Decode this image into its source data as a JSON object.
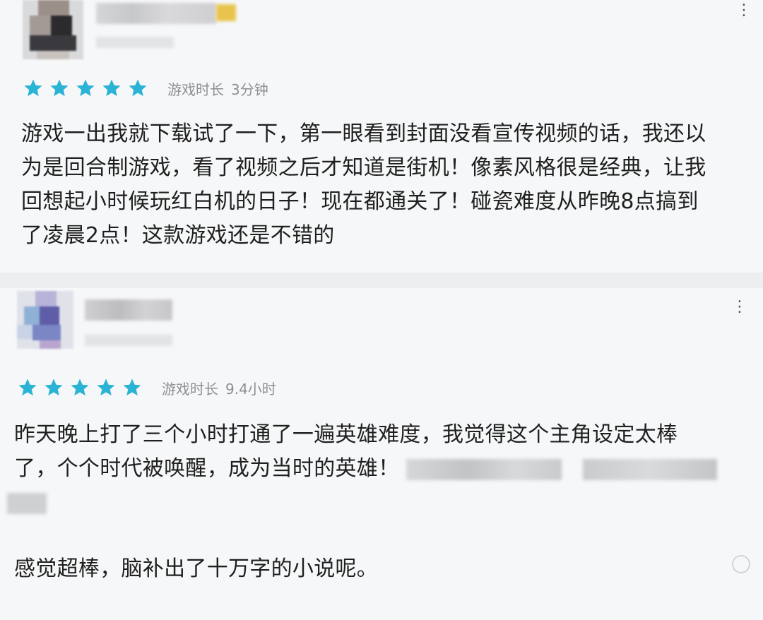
{
  "colors": {
    "star": "#2ab3d4",
    "playtime_text": "#8c9095",
    "body_text": "#1f1f1f"
  },
  "reviews": [
    {
      "rating": 5,
      "playtime_label": "游戏时长",
      "playtime_value": "3分钟",
      "more_icon": "more-vertical-icon",
      "lines": [
        "游戏一出我就下载试了一下，第一眼看到封面没看宣传视频的话，我还以",
        "为是回合制游戏，看了视频之后才知道是街机！像素风格很是经典，让我",
        "回想起小时候玩红白机的日子！现在都通关了！碰瓷难度从昨晚8点搞到",
        "了凌晨2点！这款游戏还是不错的"
      ]
    },
    {
      "rating": 5,
      "playtime_label": "游戏时长",
      "playtime_value": "9.4小时",
      "more_icon": "more-vertical-icon",
      "lines": [
        "昨天晚上打了三个小时打通了一遍英雄难度，我觉得这个主角设定太棒",
        "了，个个时代被唤醒，成为当时的英雄！"
      ],
      "extra_line": "感觉超棒，脑补出了十万字的小说呢。"
    }
  ]
}
